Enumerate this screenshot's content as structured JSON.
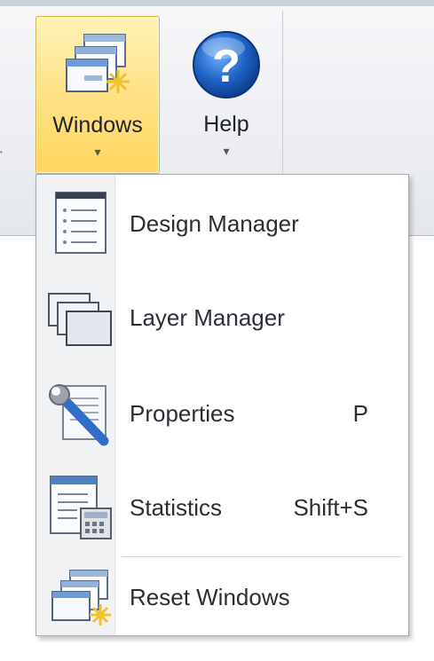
{
  "ribbon": {
    "windows_button": {
      "label": "Windows",
      "caret": "▾",
      "icon": "windows-cascade-icon"
    },
    "help_button": {
      "label": "Help",
      "caret": "▾",
      "icon": "help-icon",
      "glyph": "?"
    }
  },
  "menu": {
    "items": [
      {
        "label": "Design Manager",
        "shortcut": "",
        "icon": "design-manager-icon"
      },
      {
        "label": "Layer Manager",
        "shortcut": "",
        "icon": "layer-manager-icon"
      },
      {
        "label": "Properties",
        "shortcut": "P",
        "icon": "properties-wrench-icon"
      },
      {
        "label": "Statistics",
        "shortcut": "Shift+S",
        "icon": "statistics-icon"
      },
      {
        "label": "Reset Windows",
        "shortcut": "",
        "icon": "reset-windows-icon"
      }
    ]
  },
  "colors": {
    "highlight": "#ffd65e",
    "help_blue": "#1f63c6"
  }
}
